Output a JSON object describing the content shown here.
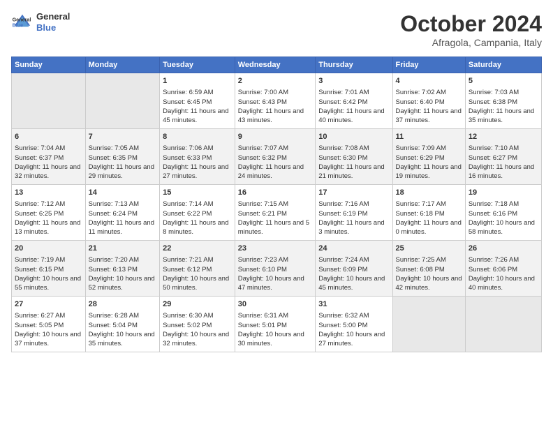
{
  "header": {
    "logo_line1": "General",
    "logo_line2": "Blue",
    "month": "October 2024",
    "location": "Afragola, Campania, Italy"
  },
  "weekdays": [
    "Sunday",
    "Monday",
    "Tuesday",
    "Wednesday",
    "Thursday",
    "Friday",
    "Saturday"
  ],
  "weeks": [
    [
      {
        "day": "",
        "info": ""
      },
      {
        "day": "",
        "info": ""
      },
      {
        "day": "1",
        "info": "Sunrise: 6:59 AM\nSunset: 6:45 PM\nDaylight: 11 hours and 45 minutes."
      },
      {
        "day": "2",
        "info": "Sunrise: 7:00 AM\nSunset: 6:43 PM\nDaylight: 11 hours and 43 minutes."
      },
      {
        "day": "3",
        "info": "Sunrise: 7:01 AM\nSunset: 6:42 PM\nDaylight: 11 hours and 40 minutes."
      },
      {
        "day": "4",
        "info": "Sunrise: 7:02 AM\nSunset: 6:40 PM\nDaylight: 11 hours and 37 minutes."
      },
      {
        "day": "5",
        "info": "Sunrise: 7:03 AM\nSunset: 6:38 PM\nDaylight: 11 hours and 35 minutes."
      }
    ],
    [
      {
        "day": "6",
        "info": "Sunrise: 7:04 AM\nSunset: 6:37 PM\nDaylight: 11 hours and 32 minutes."
      },
      {
        "day": "7",
        "info": "Sunrise: 7:05 AM\nSunset: 6:35 PM\nDaylight: 11 hours and 29 minutes."
      },
      {
        "day": "8",
        "info": "Sunrise: 7:06 AM\nSunset: 6:33 PM\nDaylight: 11 hours and 27 minutes."
      },
      {
        "day": "9",
        "info": "Sunrise: 7:07 AM\nSunset: 6:32 PM\nDaylight: 11 hours and 24 minutes."
      },
      {
        "day": "10",
        "info": "Sunrise: 7:08 AM\nSunset: 6:30 PM\nDaylight: 11 hours and 21 minutes."
      },
      {
        "day": "11",
        "info": "Sunrise: 7:09 AM\nSunset: 6:29 PM\nDaylight: 11 hours and 19 minutes."
      },
      {
        "day": "12",
        "info": "Sunrise: 7:10 AM\nSunset: 6:27 PM\nDaylight: 11 hours and 16 minutes."
      }
    ],
    [
      {
        "day": "13",
        "info": "Sunrise: 7:12 AM\nSunset: 6:25 PM\nDaylight: 11 hours and 13 minutes."
      },
      {
        "day": "14",
        "info": "Sunrise: 7:13 AM\nSunset: 6:24 PM\nDaylight: 11 hours and 11 minutes."
      },
      {
        "day": "15",
        "info": "Sunrise: 7:14 AM\nSunset: 6:22 PM\nDaylight: 11 hours and 8 minutes."
      },
      {
        "day": "16",
        "info": "Sunrise: 7:15 AM\nSunset: 6:21 PM\nDaylight: 11 hours and 5 minutes."
      },
      {
        "day": "17",
        "info": "Sunrise: 7:16 AM\nSunset: 6:19 PM\nDaylight: 11 hours and 3 minutes."
      },
      {
        "day": "18",
        "info": "Sunrise: 7:17 AM\nSunset: 6:18 PM\nDaylight: 11 hours and 0 minutes."
      },
      {
        "day": "19",
        "info": "Sunrise: 7:18 AM\nSunset: 6:16 PM\nDaylight: 10 hours and 58 minutes."
      }
    ],
    [
      {
        "day": "20",
        "info": "Sunrise: 7:19 AM\nSunset: 6:15 PM\nDaylight: 10 hours and 55 minutes."
      },
      {
        "day": "21",
        "info": "Sunrise: 7:20 AM\nSunset: 6:13 PM\nDaylight: 10 hours and 52 minutes."
      },
      {
        "day": "22",
        "info": "Sunrise: 7:21 AM\nSunset: 6:12 PM\nDaylight: 10 hours and 50 minutes."
      },
      {
        "day": "23",
        "info": "Sunrise: 7:23 AM\nSunset: 6:10 PM\nDaylight: 10 hours and 47 minutes."
      },
      {
        "day": "24",
        "info": "Sunrise: 7:24 AM\nSunset: 6:09 PM\nDaylight: 10 hours and 45 minutes."
      },
      {
        "day": "25",
        "info": "Sunrise: 7:25 AM\nSunset: 6:08 PM\nDaylight: 10 hours and 42 minutes."
      },
      {
        "day": "26",
        "info": "Sunrise: 7:26 AM\nSunset: 6:06 PM\nDaylight: 10 hours and 40 minutes."
      }
    ],
    [
      {
        "day": "27",
        "info": "Sunrise: 6:27 AM\nSunset: 5:05 PM\nDaylight: 10 hours and 37 minutes."
      },
      {
        "day": "28",
        "info": "Sunrise: 6:28 AM\nSunset: 5:04 PM\nDaylight: 10 hours and 35 minutes."
      },
      {
        "day": "29",
        "info": "Sunrise: 6:30 AM\nSunset: 5:02 PM\nDaylight: 10 hours and 32 minutes."
      },
      {
        "day": "30",
        "info": "Sunrise: 6:31 AM\nSunset: 5:01 PM\nDaylight: 10 hours and 30 minutes."
      },
      {
        "day": "31",
        "info": "Sunrise: 6:32 AM\nSunset: 5:00 PM\nDaylight: 10 hours and 27 minutes."
      },
      {
        "day": "",
        "info": ""
      },
      {
        "day": "",
        "info": ""
      }
    ]
  ]
}
